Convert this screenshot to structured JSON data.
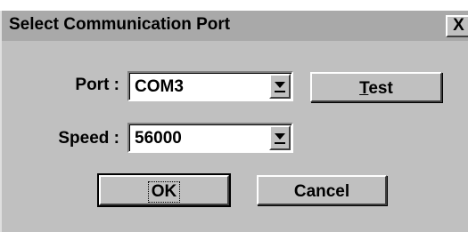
{
  "dialog": {
    "title": "Select Communication Port",
    "close_glyph": "X"
  },
  "port": {
    "label": "Port :",
    "value": "COM3"
  },
  "speed": {
    "label": "Speed :",
    "value": "56000"
  },
  "buttons": {
    "test_mnemonic": "T",
    "test_rest": "est",
    "ok": "OK",
    "cancel": "Cancel"
  },
  "icons": {
    "close": "close-icon",
    "dropdown": "chevron-down-icon"
  }
}
